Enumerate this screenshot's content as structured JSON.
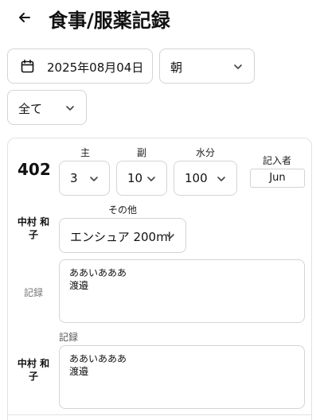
{
  "header": {
    "title": "食事/服薬記録"
  },
  "toolbar": {
    "date": "2025年08月04日",
    "meal": "朝",
    "filter": "全て"
  },
  "record": {
    "room": "402",
    "labels": {
      "main": "主",
      "side": "副",
      "water": "水分",
      "recorder": "記入者",
      "other": "その他",
      "note": "記録"
    },
    "main_value": "3",
    "side_value": "10",
    "water_value": "100",
    "recorder": "Jun",
    "other_value": "エンシュア 200ml",
    "resident_name_1": "中村 和",
    "resident_name_2": "子",
    "note_1_line1": "ああいあああ",
    "note_1_line2": "渡邉",
    "note_2_line1": "ああいあああ",
    "note_2_line2": "渡邉"
  }
}
